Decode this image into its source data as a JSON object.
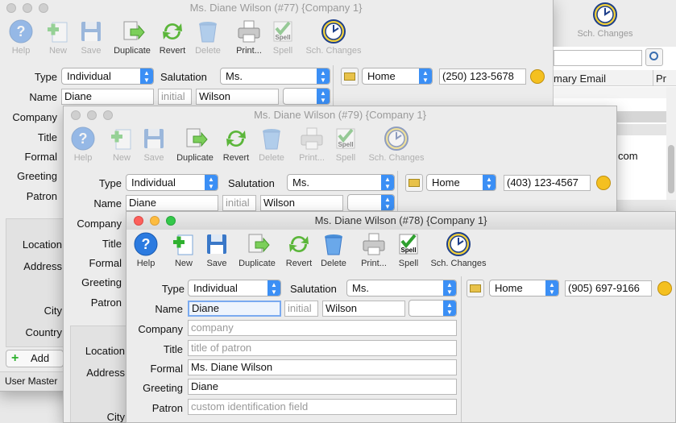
{
  "toolbar": {
    "help": "Help",
    "new": "New",
    "save": "Save",
    "duplicate": "Duplicate",
    "revert": "Revert",
    "delete": "Delete",
    "print": "Print...",
    "spell": "Spell",
    "spell_badge": "Spell",
    "sch_changes": "Sch. Changes"
  },
  "form": {
    "type_label": "Type",
    "salutation_label": "Salutation",
    "name_label": "Name",
    "company_label": "Company",
    "title_label": "Title",
    "formal_label": "Formal",
    "greeting_label": "Greeting",
    "patron_label": "Patron",
    "location_label": "Location",
    "address_label": "Address",
    "city_label": "City",
    "country_label": "Country"
  },
  "win77": {
    "title": "Ms. Diane Wilson (#77) {Company 1}",
    "type": "Individual",
    "salutation": "Ms.",
    "first": "Diane",
    "middle": "initial",
    "last": "Wilson",
    "phone_type": "Home",
    "phone": "(250) 123-5678",
    "col_primary_email": "mary Email",
    "col_pr": "Pr",
    "email_fragment": "com",
    "add": "Add",
    "status": "User Master"
  },
  "win79": {
    "title": "Ms. Diane Wilson (#79) {Company 1}",
    "type": "Individual",
    "salutation": "Ms.",
    "first": "Diane",
    "middle": "initial",
    "last": "Wilson",
    "phone_type": "Home",
    "phone": "(403) 123-4567"
  },
  "win78": {
    "title": "Ms. Diane Wilson (#78) {Company 1}",
    "type": "Individual",
    "salutation": "Ms.",
    "first": "Diane",
    "middle": "initial",
    "last": "Wilson",
    "company_ph": "company",
    "title_ph": "title of patron",
    "formal": "Ms. Diane Wilson",
    "greeting": "Diane",
    "patron_ph": "custom identification field",
    "phone_type": "Home",
    "phone": "(905) 697-9166"
  },
  "bg": {
    "sch_changes": "Sch. Changes"
  },
  "colors": {
    "accent": "#3b8ff5",
    "help_blue": "#2c7be0"
  }
}
